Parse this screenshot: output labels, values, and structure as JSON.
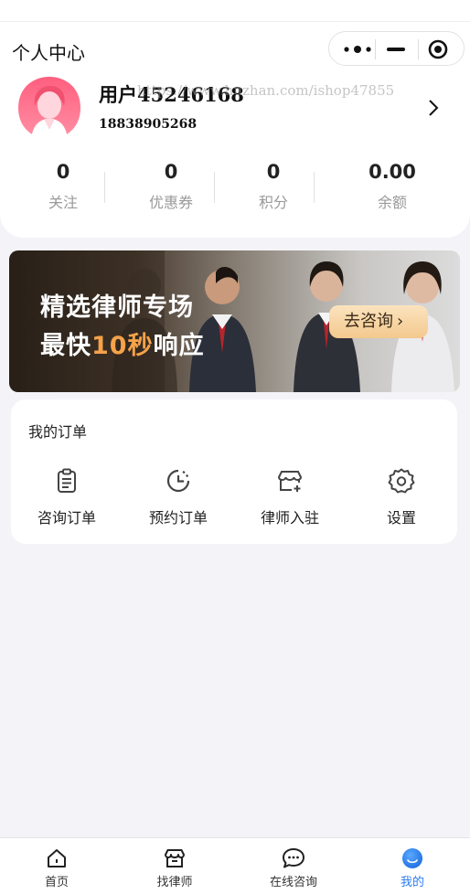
{
  "nav": {
    "title": "个人中心"
  },
  "capsule": {
    "more_icon": "more-dots-icon",
    "minimize_icon": "minimize-icon",
    "close_icon": "target-close-icon"
  },
  "profile": {
    "username": "用户45246168",
    "phone": "18838905268",
    "watermark": "https://www.huzhan.com/ishop47855"
  },
  "stats": [
    {
      "value": "0",
      "label": "关注"
    },
    {
      "value": "0",
      "label": "优惠券"
    },
    {
      "value": "0",
      "label": "积分"
    },
    {
      "value": "0.00",
      "label": "余额"
    }
  ],
  "banner": {
    "line1": "精选律师专场",
    "line2_a": "最快",
    "line2_hl": "10秒",
    "line2_b": "响应",
    "button": "去咨询",
    "highlight_color": "#f5a24a"
  },
  "orders": {
    "title": "我的订单",
    "items": [
      {
        "label": "咨询订单",
        "icon": "clipboard-icon"
      },
      {
        "label": "预约订单",
        "icon": "clock-icon"
      },
      {
        "label": "律师入驻",
        "icon": "shop-add-icon"
      },
      {
        "label": "设置",
        "icon": "gear-icon"
      }
    ]
  },
  "tabbar": {
    "active_color": "#2a7cf4",
    "items": [
      {
        "label": "首页",
        "icon": "home-icon"
      },
      {
        "label": "找律师",
        "icon": "store-icon"
      },
      {
        "label": "在线咨询",
        "icon": "chat-icon"
      },
      {
        "label": "我的",
        "icon": "profile-icon"
      }
    ]
  }
}
